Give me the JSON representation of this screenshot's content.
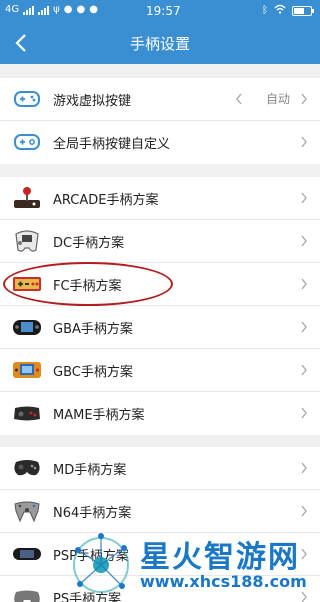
{
  "status": {
    "network": "4G",
    "time": "19:57"
  },
  "header": {
    "title": "手柄设置"
  },
  "section1": [
    {
      "label": "游戏虚拟按键",
      "value": "自动",
      "icon": "gamepad-outline-icon"
    },
    {
      "label": "全局手柄按键自定义",
      "icon": "gamepad-settings-icon"
    }
  ],
  "section2": [
    {
      "label": "ARCADE手柄方案",
      "icon": "arcade-stick-icon"
    },
    {
      "label": "DC手柄方案",
      "icon": "dreamcast-controller-icon"
    },
    {
      "label": "FC手柄方案",
      "icon": "famicom-controller-icon"
    },
    {
      "label": "GBA手柄方案",
      "icon": "gba-icon"
    },
    {
      "label": "GBC手柄方案",
      "icon": "gbc-icon"
    },
    {
      "label": "MAME手柄方案",
      "icon": "mame-controller-icon"
    }
  ],
  "section3": [
    {
      "label": "MD手柄方案",
      "icon": "md-controller-icon"
    },
    {
      "label": "N64手柄方案",
      "icon": "n64-controller-icon"
    },
    {
      "label": "PSP手柄方案",
      "icon": "psp-icon"
    },
    {
      "label": "PS手柄方案",
      "icon": "ps-controller-icon"
    }
  ],
  "watermark": {
    "title": "星火智游网",
    "url": "www.xhcs188.com"
  },
  "colors": {
    "accent": "#3a8fd3",
    "highlight": "#b31d1d",
    "watermark": "#1a78c6"
  }
}
